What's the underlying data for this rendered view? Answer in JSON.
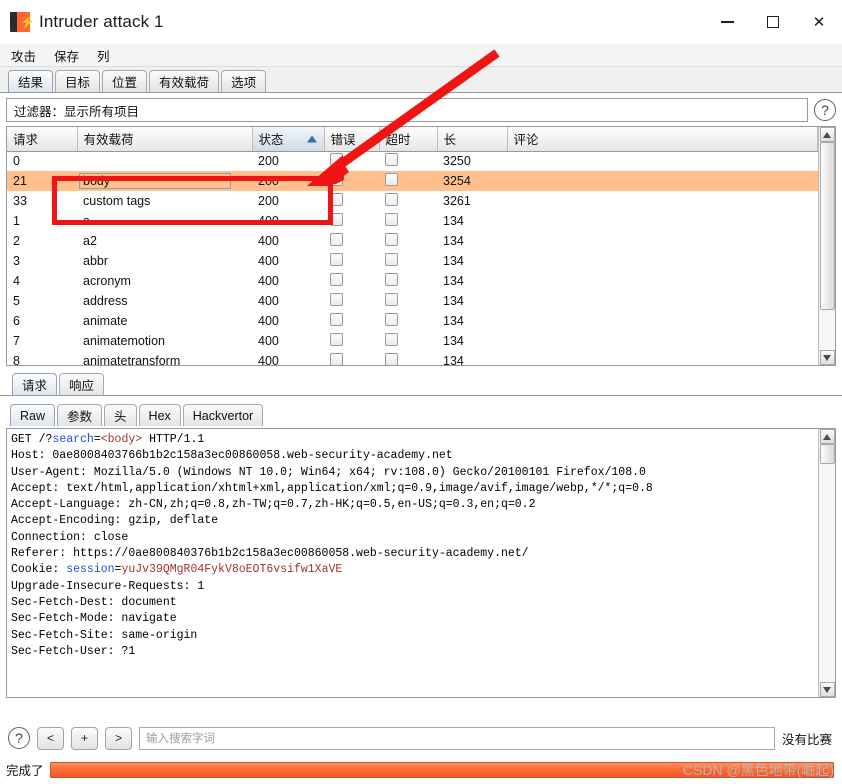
{
  "window": {
    "title": "Intruder attack 1",
    "icon": "burp-suite-icon",
    "controls": {
      "minimize": "—",
      "maximize": "□",
      "close": "✕"
    }
  },
  "menubar": {
    "items": [
      "攻击",
      "保存",
      "列"
    ]
  },
  "tabs": [
    {
      "label": "结果",
      "active": true
    },
    {
      "label": "目标",
      "active": false
    },
    {
      "label": "位置",
      "active": false
    },
    {
      "label": "有效载荷",
      "active": false
    },
    {
      "label": "选项",
      "active": false
    }
  ],
  "filter": {
    "label": "过滤器：",
    "value": "显示所有项目",
    "help": "?"
  },
  "results_table": {
    "columns": [
      "请求",
      "有效载荷",
      "状态",
      "错误",
      "超时",
      "长",
      "评论"
    ],
    "sorted_column": "状态",
    "sort_direction": "asc",
    "rows": [
      {
        "request": "0",
        "payload": "",
        "status": "200",
        "error": false,
        "timeout": false,
        "length": "3250",
        "comment": "",
        "selected": false,
        "payload_focus": false
      },
      {
        "request": "21",
        "payload": "body",
        "status": "200",
        "error": false,
        "timeout": false,
        "length": "3254",
        "comment": "",
        "selected": true,
        "payload_focus": true
      },
      {
        "request": "33",
        "payload": "custom tags",
        "status": "200",
        "error": false,
        "timeout": false,
        "length": "3261",
        "comment": "",
        "selected": false,
        "payload_focus": false
      },
      {
        "request": "1",
        "payload": "a",
        "status": "400",
        "error": false,
        "timeout": false,
        "length": "134",
        "comment": "",
        "selected": false,
        "payload_focus": false
      },
      {
        "request": "2",
        "payload": "a2",
        "status": "400",
        "error": false,
        "timeout": false,
        "length": "134",
        "comment": "",
        "selected": false,
        "payload_focus": false
      },
      {
        "request": "3",
        "payload": "abbr",
        "status": "400",
        "error": false,
        "timeout": false,
        "length": "134",
        "comment": "",
        "selected": false,
        "payload_focus": false
      },
      {
        "request": "4",
        "payload": "acronym",
        "status": "400",
        "error": false,
        "timeout": false,
        "length": "134",
        "comment": "",
        "selected": false,
        "payload_focus": false
      },
      {
        "request": "5",
        "payload": "address",
        "status": "400",
        "error": false,
        "timeout": false,
        "length": "134",
        "comment": "",
        "selected": false,
        "payload_focus": false
      },
      {
        "request": "6",
        "payload": "animate",
        "status": "400",
        "error": false,
        "timeout": false,
        "length": "134",
        "comment": "",
        "selected": false,
        "payload_focus": false
      },
      {
        "request": "7",
        "payload": "animatemotion",
        "status": "400",
        "error": false,
        "timeout": false,
        "length": "134",
        "comment": "",
        "selected": false,
        "payload_focus": false
      },
      {
        "request": "8",
        "payload": "animatetransform",
        "status": "400",
        "error": false,
        "timeout": false,
        "length": "134",
        "comment": "",
        "selected": false,
        "payload_focus": false
      }
    ]
  },
  "message_tabs": [
    {
      "label": "请求",
      "active": true
    },
    {
      "label": "响应",
      "active": false
    }
  ],
  "view_tabs": [
    {
      "label": "Raw",
      "active": true
    },
    {
      "label": "参数",
      "active": false
    },
    {
      "label": "头",
      "active": false
    },
    {
      "label": "Hex",
      "active": false
    },
    {
      "label": "Hackvertor",
      "active": false
    }
  ],
  "request": {
    "line1_prefix": "GET /?",
    "line1_param": "search",
    "line1_eq": "=",
    "line1_value": "<body>",
    "line1_suffix": " HTTP/1.1",
    "headers": [
      "Host: 0ae8008403766b1b2c158a3ec00860058.web-security-academy.net",
      "User-Agent: Mozilla/5.0 (Windows NT 10.0; Win64; x64; rv:108.0) Gecko/20100101 Firefox/108.0",
      "Accept: text/html,application/xhtml+xml,application/xml;q=0.9,image/avif,image/webp,*/*;q=0.8",
      "Accept-Language: zh-CN,zh;q=0.8,zh-TW;q=0.7,zh-HK;q=0.5,en-US;q=0.3,en;q=0.2",
      "Accept-Encoding: gzip, deflate",
      "Connection: close",
      "Referer: https://0ae800840376b1b2c158a3ec00860058.web-security-academy.net/"
    ],
    "cookie_label": "Cookie: ",
    "cookie_name": "session",
    "cookie_eq": "=",
    "cookie_value": "yuJv39QMgR04FykV8oEOT6vsifw1XaVE",
    "headers_after_cookie": [
      "Upgrade-Insecure-Requests: 1",
      "Sec-Fetch-Dest: document",
      "Sec-Fetch-Mode: navigate",
      "Sec-Fetch-Site: same-origin",
      "Sec-Fetch-User: ?1"
    ]
  },
  "bottom_toolbar": {
    "help": "?",
    "prev": "<",
    "add": "+",
    "next": ">",
    "search_placeholder": "输入搜索字词",
    "match_status": "没有比赛"
  },
  "statusbar": {
    "status": "完成了",
    "progress_percent": 100,
    "watermark": "CSDN @黑色地带(崛起)"
  },
  "colors": {
    "selected_row": "#ffc08c",
    "annotation_red": "#f01414",
    "progress_orange": "#ff6a33",
    "accent_blue": "#3b6ea5"
  }
}
